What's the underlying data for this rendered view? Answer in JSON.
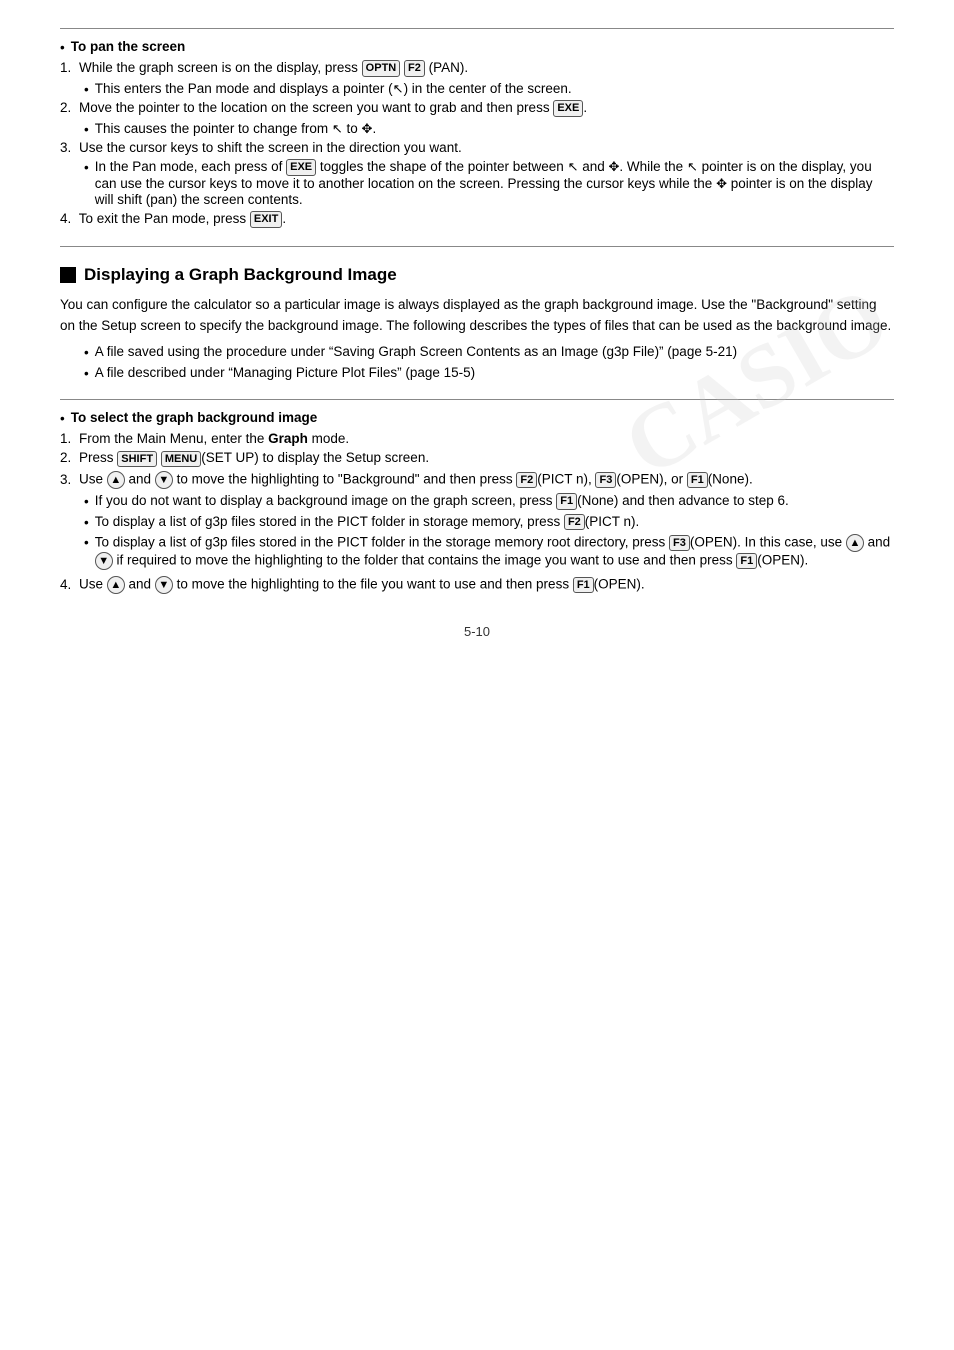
{
  "page": {
    "top_rule": true,
    "sections": [
      {
        "type": "bullet-title-section",
        "title": "To pan the screen",
        "items": [
          {
            "type": "numbered",
            "num": "1.",
            "text_parts": [
              {
                "text": "While the graph screen is on the display, press "
              },
              {
                "key": "OPTN"
              },
              {
                "text": " "
              },
              {
                "key": "F2"
              },
              {
                "text": "(PAN)."
              }
            ],
            "sub_bullets": [
              {
                "text_parts": [
                  {
                    "text": "This enters the Pan mode and displays a pointer ("
                  },
                  {
                    "icon": "cursor-arrow"
                  },
                  {
                    "text": ") in the center of the screen."
                  }
                ]
              }
            ]
          },
          {
            "type": "numbered",
            "num": "2.",
            "text_parts": [
              {
                "text": "Move the pointer to the location on the screen you want to grab and then press "
              },
              {
                "key": "EXE"
              },
              {
                "text": "."
              }
            ],
            "sub_bullets": [
              {
                "text_parts": [
                  {
                    "text": "This causes the pointer to change from "
                  },
                  {
                    "icon": "cursor-arrow"
                  },
                  {
                    "text": " to "
                  },
                  {
                    "icon": "cursor-pan"
                  },
                  {
                    "text": "."
                  }
                ]
              }
            ]
          },
          {
            "type": "numbered",
            "num": "3.",
            "text_parts": [
              {
                "text": "Use the cursor keys to shift the screen in the direction you want."
              }
            ],
            "sub_bullets": [
              {
                "text_parts": [
                  {
                    "text": "In the Pan mode, each press of "
                  },
                  {
                    "key": "EXE"
                  },
                  {
                    "text": " toggles the shape of the pointer between "
                  },
                  {
                    "icon": "cursor-arrow"
                  },
                  {
                    "text": " and "
                  },
                  {
                    "icon": "cursor-pan"
                  },
                  {
                    "text": ". While the "
                  },
                  {
                    "icon": "cursor-arrow"
                  },
                  {
                    "text": " pointer is on the display, you can use the cursor keys to move it to another location on the screen. Pressing the cursor keys while the "
                  },
                  {
                    "icon": "cursor-pan"
                  },
                  {
                    "text": " pointer is on the display will shift (pan) the screen contents."
                  }
                ]
              }
            ]
          },
          {
            "type": "numbered",
            "num": "4.",
            "text_parts": [
              {
                "text": "To exit the Pan mode, press "
              },
              {
                "key": "EXIT"
              },
              {
                "text": "."
              }
            ]
          }
        ]
      },
      {
        "type": "major-section",
        "title": "Displaying a Graph Background Image",
        "body": "You can configure the calculator so a particular image is always displayed as the graph background image. Use the \"Background\" setting on the Setup screen to specify the background image. The following describes the types of files that can be used as the background image.",
        "bullets": [
          "A file saved using the procedure under “Saving Graph Screen Contents as an Image (g3p File)” (page 5-21)",
          "A file described under “Managing Picture Plot Files” (page 15-5)"
        ]
      },
      {
        "type": "bullet-title-section",
        "title": "To select the graph background image",
        "items": [
          {
            "type": "numbered",
            "num": "1.",
            "text_parts": [
              {
                "text": "From the Main Menu, enter the "
              },
              {
                "bold": "Graph"
              },
              {
                "text": " mode."
              }
            ]
          },
          {
            "type": "numbered",
            "num": "2.",
            "text_parts": [
              {
                "text": "Press "
              },
              {
                "key": "SHIFT"
              },
              {
                "text": " "
              },
              {
                "key": "MENU"
              },
              {
                "text": "(SET UP) to display the Setup screen."
              }
            ]
          },
          {
            "type": "numbered",
            "num": "3.",
            "text_parts": [
              {
                "text": "Use "
              },
              {
                "key_circle": "up"
              },
              {
                "text": " and "
              },
              {
                "key_circle": "down"
              },
              {
                "text": " to move the highlighting to “Background” and then press "
              },
              {
                "key": "F2"
              },
              {
                "text": "(PICT n), "
              },
              {
                "key": "F3"
              },
              {
                "text": "(OPEN), or "
              },
              {
                "key": "F1"
              },
              {
                "text": "(None)."
              }
            ],
            "sub_bullets": [
              {
                "text_parts": [
                  {
                    "text": "If you do not want to display a background image on the graph screen, press "
                  },
                  {
                    "key": "F1"
                  },
                  {
                    "text": "(None) and then advance to step 6."
                  }
                ]
              },
              {
                "text_parts": [
                  {
                    "text": "To display a list of g3p files stored in the PICT folder in storage memory, press "
                  },
                  {
                    "key": "F2"
                  },
                  {
                    "text": "(PICT n)."
                  }
                ]
              },
              {
                "text_parts": [
                  {
                    "text": "To display a list of g3p files stored in the PICT folder in the storage memory root directory, press "
                  },
                  {
                    "key": "F3"
                  },
                  {
                    "text": "(OPEN). In this case, use "
                  },
                  {
                    "key_circle": "up"
                  },
                  {
                    "text": " and "
                  },
                  {
                    "key_circle": "down"
                  },
                  {
                    "text": " if required to move the highlighting to the folder that contains the image you want to use and then press "
                  },
                  {
                    "key": "F1"
                  },
                  {
                    "text": "(OPEN)."
                  }
                ]
              }
            ]
          },
          {
            "type": "numbered",
            "num": "4.",
            "text_parts": [
              {
                "text": "Use "
              },
              {
                "key_circle": "up"
              },
              {
                "text": " and "
              },
              {
                "key_circle": "down"
              },
              {
                "text": " to move the highlighting to the file you want to use and then press "
              },
              {
                "key": "F1"
              },
              {
                "text": "(OPEN)."
              }
            ]
          }
        ]
      }
    ],
    "page_number": "5-10"
  }
}
